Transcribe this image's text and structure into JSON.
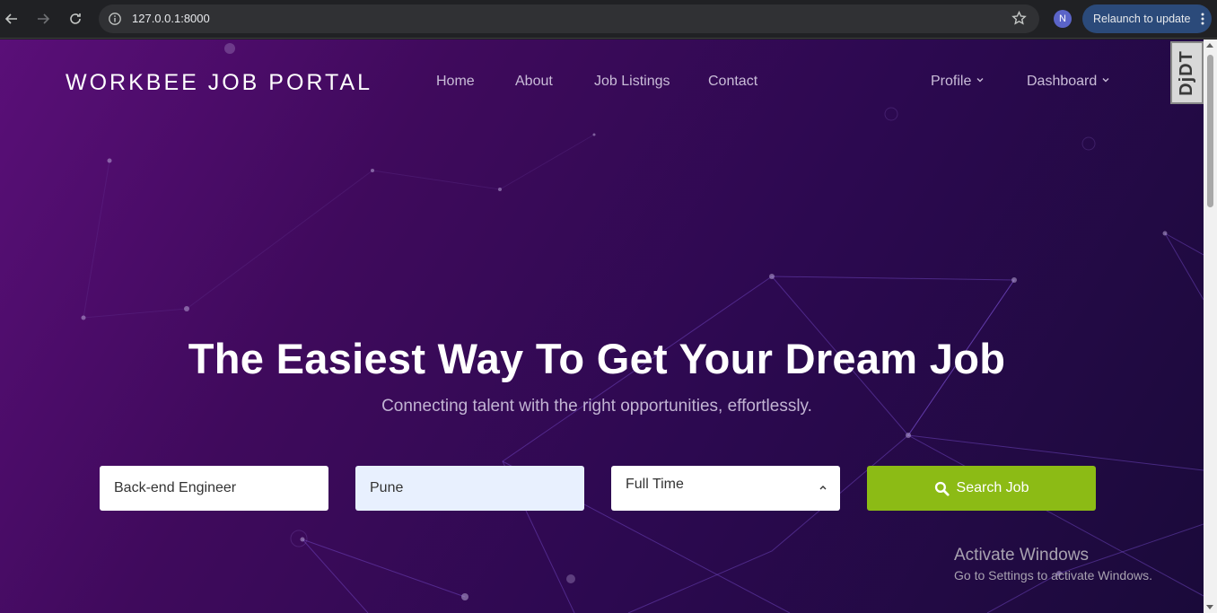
{
  "browser": {
    "url": "127.0.0.1:8000",
    "profile_initial": "N",
    "relaunch_label": "Relaunch to update"
  },
  "site": {
    "brand": "WORKBEE JOB PORTAL",
    "nav": [
      "Home",
      "About",
      "Job Listings",
      "Contact"
    ],
    "profile_menu": "Profile",
    "dashboard_menu": "Dashboard"
  },
  "hero": {
    "title": "The Easiest Way To Get Your Dream Job",
    "subtitle": "Connecting talent with the right opportunities, effortlessly."
  },
  "search": {
    "keyword_value": "Back-end Engineer",
    "location_value": "Pune",
    "job_type_selected": "Full Time",
    "button_label": "Search Job"
  },
  "debug_toolbar": {
    "label": "DjDT"
  },
  "os_notice": {
    "title": "Activate Windows",
    "message": "Go to Settings to activate Windows."
  },
  "colors": {
    "accent_button": "#8cbb15",
    "background_gradient_start": "#5a0f78",
    "background_gradient_end": "#1a0a3a"
  }
}
